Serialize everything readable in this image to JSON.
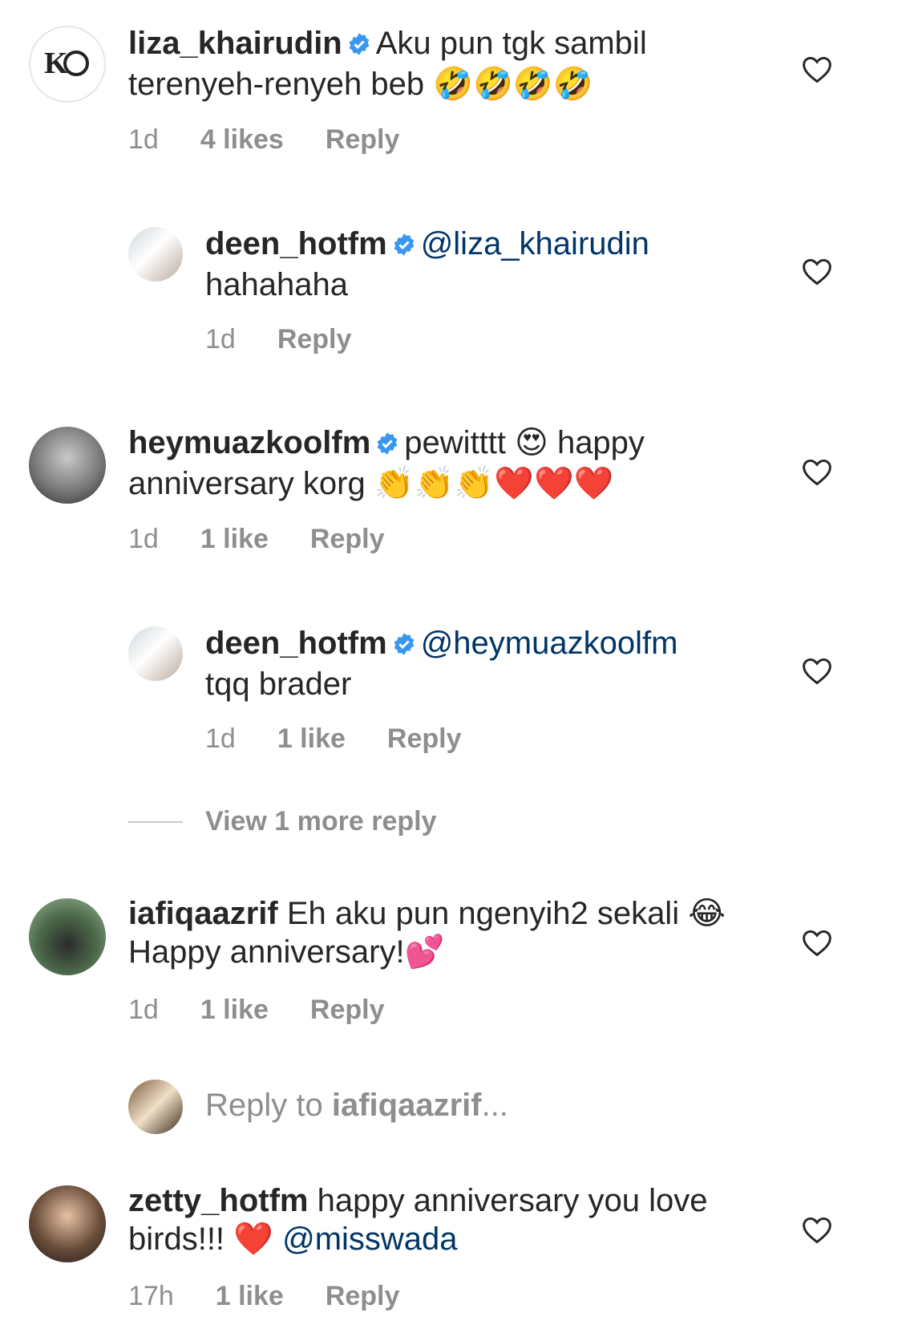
{
  "comments": [
    {
      "username": "liza_khairudin",
      "text": "Aku pun tgk sambil terenyeh-renyeh beb 🤣🤣🤣🤣",
      "time": "1d",
      "likes": "4 likes",
      "reply": "Reply"
    },
    {
      "username": "deen_hotfm",
      "mention": "@liza_khairudin",
      "text": "hahahaha",
      "time": "1d",
      "reply": "Reply"
    },
    {
      "username": "heymuazkoolfm",
      "text": "pewitttt 😍 happy anniversary korg 👏👏👏❤️❤️❤️",
      "time": "1d",
      "likes": "1 like",
      "reply": "Reply"
    },
    {
      "username": "deen_hotfm",
      "mention": "@heymuazkoolfm",
      "text": "tqq brader",
      "time": "1d",
      "likes": "1 like",
      "reply": "Reply"
    },
    {
      "username": "iafiqaazrif",
      "text": "Eh aku pun ngenyih2 sekali 😂 Happy anniversary!💕",
      "time": "1d",
      "likes": "1 like",
      "reply": "Reply"
    },
    {
      "username": "zetty_hotfm",
      "text": "happy anniversary you love birds!!! ❤️",
      "mention": "@misswada",
      "time": "17h",
      "likes": "1 like",
      "reply": "Reply"
    }
  ],
  "view_more": "View 1 more reply",
  "reply_box": {
    "prefix": "Reply to ",
    "target": "iafiqaazrif",
    "suffix": "..."
  },
  "logo_text": "KO",
  "colors": {
    "text": "#262626",
    "meta": "#8e8e8e",
    "mention": "#003569",
    "verified": "#3897f0"
  },
  "icons": [
    "verified-badge-icon",
    "heart-icon"
  ]
}
